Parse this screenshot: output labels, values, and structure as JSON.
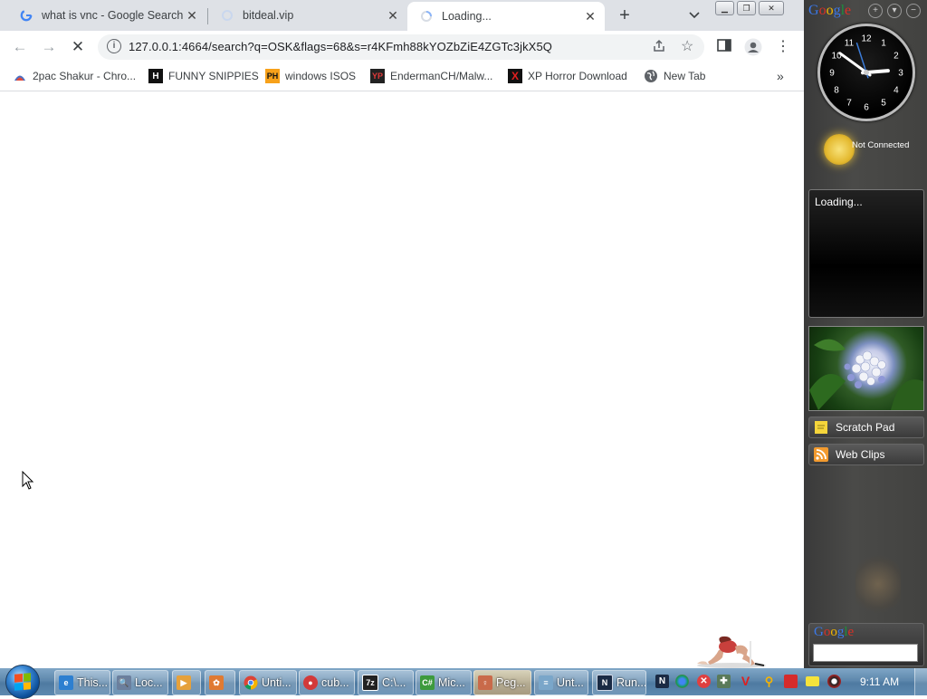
{
  "browser": {
    "tabs": [
      {
        "title": "what is vnc - Google Search",
        "favicon": "google-g-icon"
      },
      {
        "title": "bitdeal.vip",
        "favicon": "loading-icon"
      },
      {
        "title": "Loading...",
        "favicon": "loading-spinner-icon",
        "active": true
      }
    ],
    "new_tab_label": "+",
    "omnibox": {
      "url": "127.0.0.1:4664/search?q=OSK&flags=68&s=r4KFmh88kYOZbZiE4ZGTc3jkX5Q"
    },
    "bookmarks": [
      {
        "label": "2pac Shakur - Chro...",
        "icon": "2pac-favicon"
      },
      {
        "label": "FUNNY SNIPPIES",
        "icon": "h-box-favicon"
      },
      {
        "label": "windows ISOS",
        "icon": "ph-favicon"
      },
      {
        "label": "EndermanCH/Malw...",
        "icon": "yp-favicon"
      },
      {
        "label": "XP Horror Download",
        "icon": "red-x-favicon"
      },
      {
        "label": "New Tab",
        "icon": "globe-favicon"
      }
    ],
    "bookmarks_overflow": "»"
  },
  "gadgets": {
    "title": "Google",
    "weather_status": "Not Connected",
    "news_status": "Loading...",
    "scratch_pad_label": "Scratch Pad",
    "web_clips_label": "Web Clips",
    "search_logo": "Google",
    "clock": {
      "hour": 2,
      "minute": 51,
      "second": 27,
      "numbers": [
        "12",
        "1",
        "2",
        "3",
        "4",
        "5",
        "6",
        "7",
        "8",
        "9",
        "10",
        "11"
      ]
    }
  },
  "taskbar": {
    "buttons": [
      {
        "label": "This...",
        "icon": "ie-icon",
        "color": "#2d7fd0"
      },
      {
        "label": "Loc...",
        "icon": "magnifier-icon",
        "color": "#6b7f9d"
      },
      {
        "label": "",
        "icon": "media-player-icon",
        "color": "#e6a13b"
      },
      {
        "label": "",
        "icon": "app-icon",
        "color": "#e07a32"
      },
      {
        "label": "Unti...",
        "icon": "chrome-icon",
        "color": "#db4437"
      },
      {
        "label": "cub...",
        "icon": "record-icon",
        "color": "#d23a3a"
      },
      {
        "label": "C:\\...",
        "icon": "7zip-icon",
        "color": "#222222"
      },
      {
        "label": "Mic...",
        "icon": "csharp-icon",
        "color": "#3d9a3d"
      },
      {
        "label": "Peg...",
        "icon": "pegdancer-icon",
        "color": "#c96a4a",
        "active": true
      },
      {
        "label": "Unt...",
        "icon": "notepad-icon",
        "color": "#7aa6c9"
      },
      {
        "label": "Run...",
        "icon": "terminal-icon",
        "color": "#1a2a44"
      }
    ],
    "clock": "9:11 AM"
  }
}
